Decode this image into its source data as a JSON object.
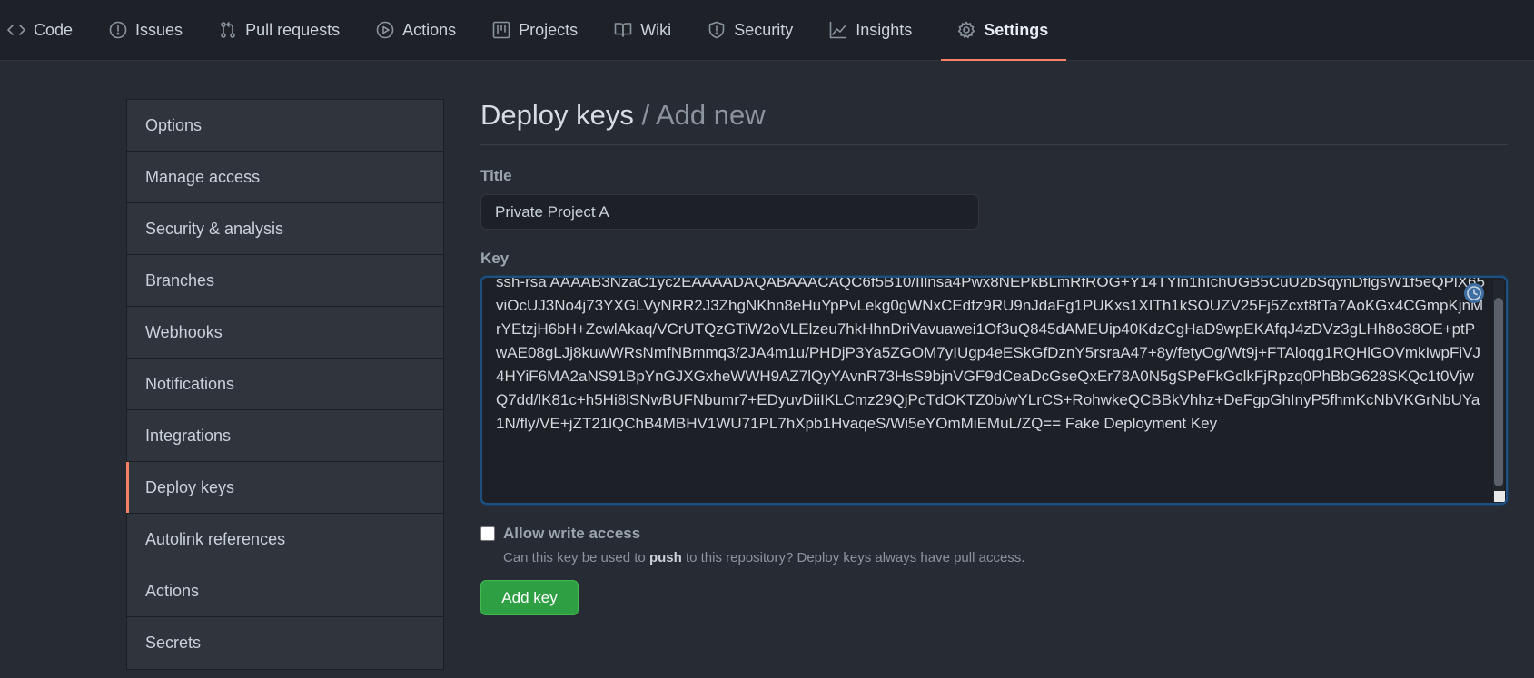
{
  "nav": {
    "tabs": [
      {
        "label": "Code",
        "icon": "code-icon"
      },
      {
        "label": "Issues",
        "icon": "issue-icon"
      },
      {
        "label": "Pull requests",
        "icon": "pull-request-icon"
      },
      {
        "label": "Actions",
        "icon": "play-icon"
      },
      {
        "label": "Projects",
        "icon": "project-icon"
      },
      {
        "label": "Wiki",
        "icon": "book-icon"
      },
      {
        "label": "Security",
        "icon": "shield-icon"
      },
      {
        "label": "Insights",
        "icon": "graph-icon"
      },
      {
        "label": "Settings",
        "icon": "gear-icon"
      }
    ],
    "active": "Settings"
  },
  "sidebar": {
    "items": [
      {
        "label": "Options"
      },
      {
        "label": "Manage access"
      },
      {
        "label": "Security & analysis"
      },
      {
        "label": "Branches"
      },
      {
        "label": "Webhooks"
      },
      {
        "label": "Notifications"
      },
      {
        "label": "Integrations"
      },
      {
        "label": "Deploy keys"
      },
      {
        "label": "Autolink references"
      },
      {
        "label": "Actions"
      },
      {
        "label": "Secrets"
      }
    ],
    "selected": "Deploy keys"
  },
  "page": {
    "title": "Deploy keys",
    "subtitle": "/ Add new"
  },
  "form": {
    "title_label": "Title",
    "title_value": "Private Project A",
    "key_label": "Key",
    "key_value": "ssh-rsa AAAAB3NzaC1yc2EAAAADAQABAAACAQC6f5B10/IIlnsa4Pwx8NEPkBLmRfROG+Y14TYln1hIchUGB5CuU2bSqynDflgsW1f5eQPlX65viOcUJ3No4j73YXGLVyNRR2J3ZhgNKhn8eHuYpPvLekg0gWNxCEdfz9RU9nJdaFg1PUKxs1XITh1kSOUZV25Fj5Zcxt8tTa7AoKGx4CGmpKjnMrYEtzjH6bH+ZcwlAkaq/VCrUTQzGTiW2oVLElzeu7hkHhnDriVavuawei1Of3uQ845dAMEUip40KdzCgHaD9wpEKAfqJ4zDVz3gLHh8o38OE+ptPwAE08gLJj8kuwWRsNmfNBmmq3/2JA4m1u/PHDjP3Ya5ZGOM7yIUgp4eESkGfDznY5rsraA47+8y/fetyOg/Wt9j+FTAloqg1RQHlGOVmkIwpFiVJ4HYiF6MA2aNS91BpYnGJXGxheWWH9AZ7lQyYAvnR73HsS9bjnVGF9dCeaDcGseQxEr78A0N5gSPeFkGclkFjRpzq0PhBbG628SKQc1t0VjwQ7dd/lK81c+h5Hi8lSNwBUFNbumr7+EDyuvDiiIKLCmz29QjPcTdOKTZ0b/wYLrCS+RohwkeQCBBkVhhz+DeFgpGhInyP5fhmKcNbVKGrNbUYa1N/fly/VE+jZT21lQChB4MBHV1WU71PL7hXpb1HvaqeS/Wi5eYOmMiEMuL/ZQ== Fake Deployment Key",
    "write_access_label": "Allow write access",
    "hint_before": "Can this key be used to ",
    "hint_bold": "push",
    "hint_after": " to this repository? Deploy keys always have pull access.",
    "submit_label": "Add key"
  },
  "colors": {
    "accent": "#f78166",
    "button_green": "#2ea043",
    "focus_border": "#1f4f7e"
  }
}
